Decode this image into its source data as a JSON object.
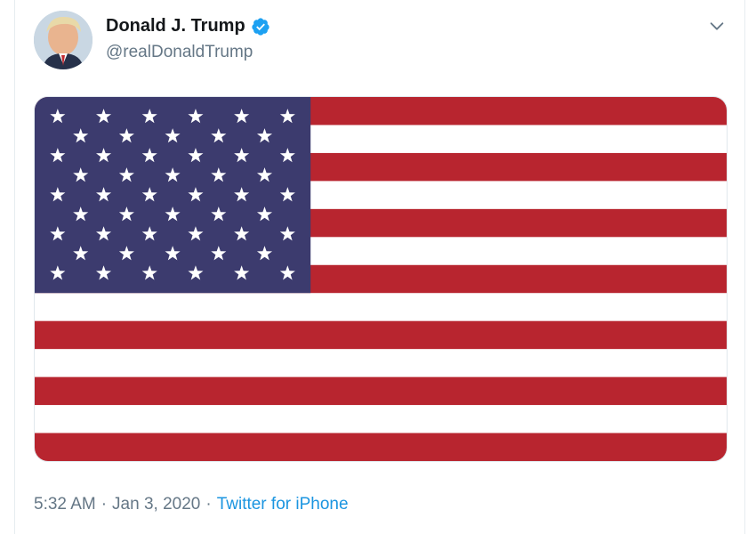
{
  "tweet": {
    "author": {
      "display_name": "Donald J. Trump",
      "handle": "@realDonaldTrump",
      "verified": true,
      "verified_icon": "verified-badge-icon"
    },
    "menu_icon": "chevron-down-icon",
    "media": {
      "description_icon": "us-flag-image",
      "colors": {
        "red": "#b8252f",
        "white": "#ffffff",
        "blue": "#3c3b6e"
      }
    },
    "time": "5:32 AM",
    "separator": "·",
    "date": "Jan 3, 2020",
    "source": "Twitter for iPhone"
  },
  "colors": {
    "text_primary": "#14171a",
    "text_secondary": "#657786",
    "accent": "#1b95e0",
    "verified": "#1da1f2"
  }
}
